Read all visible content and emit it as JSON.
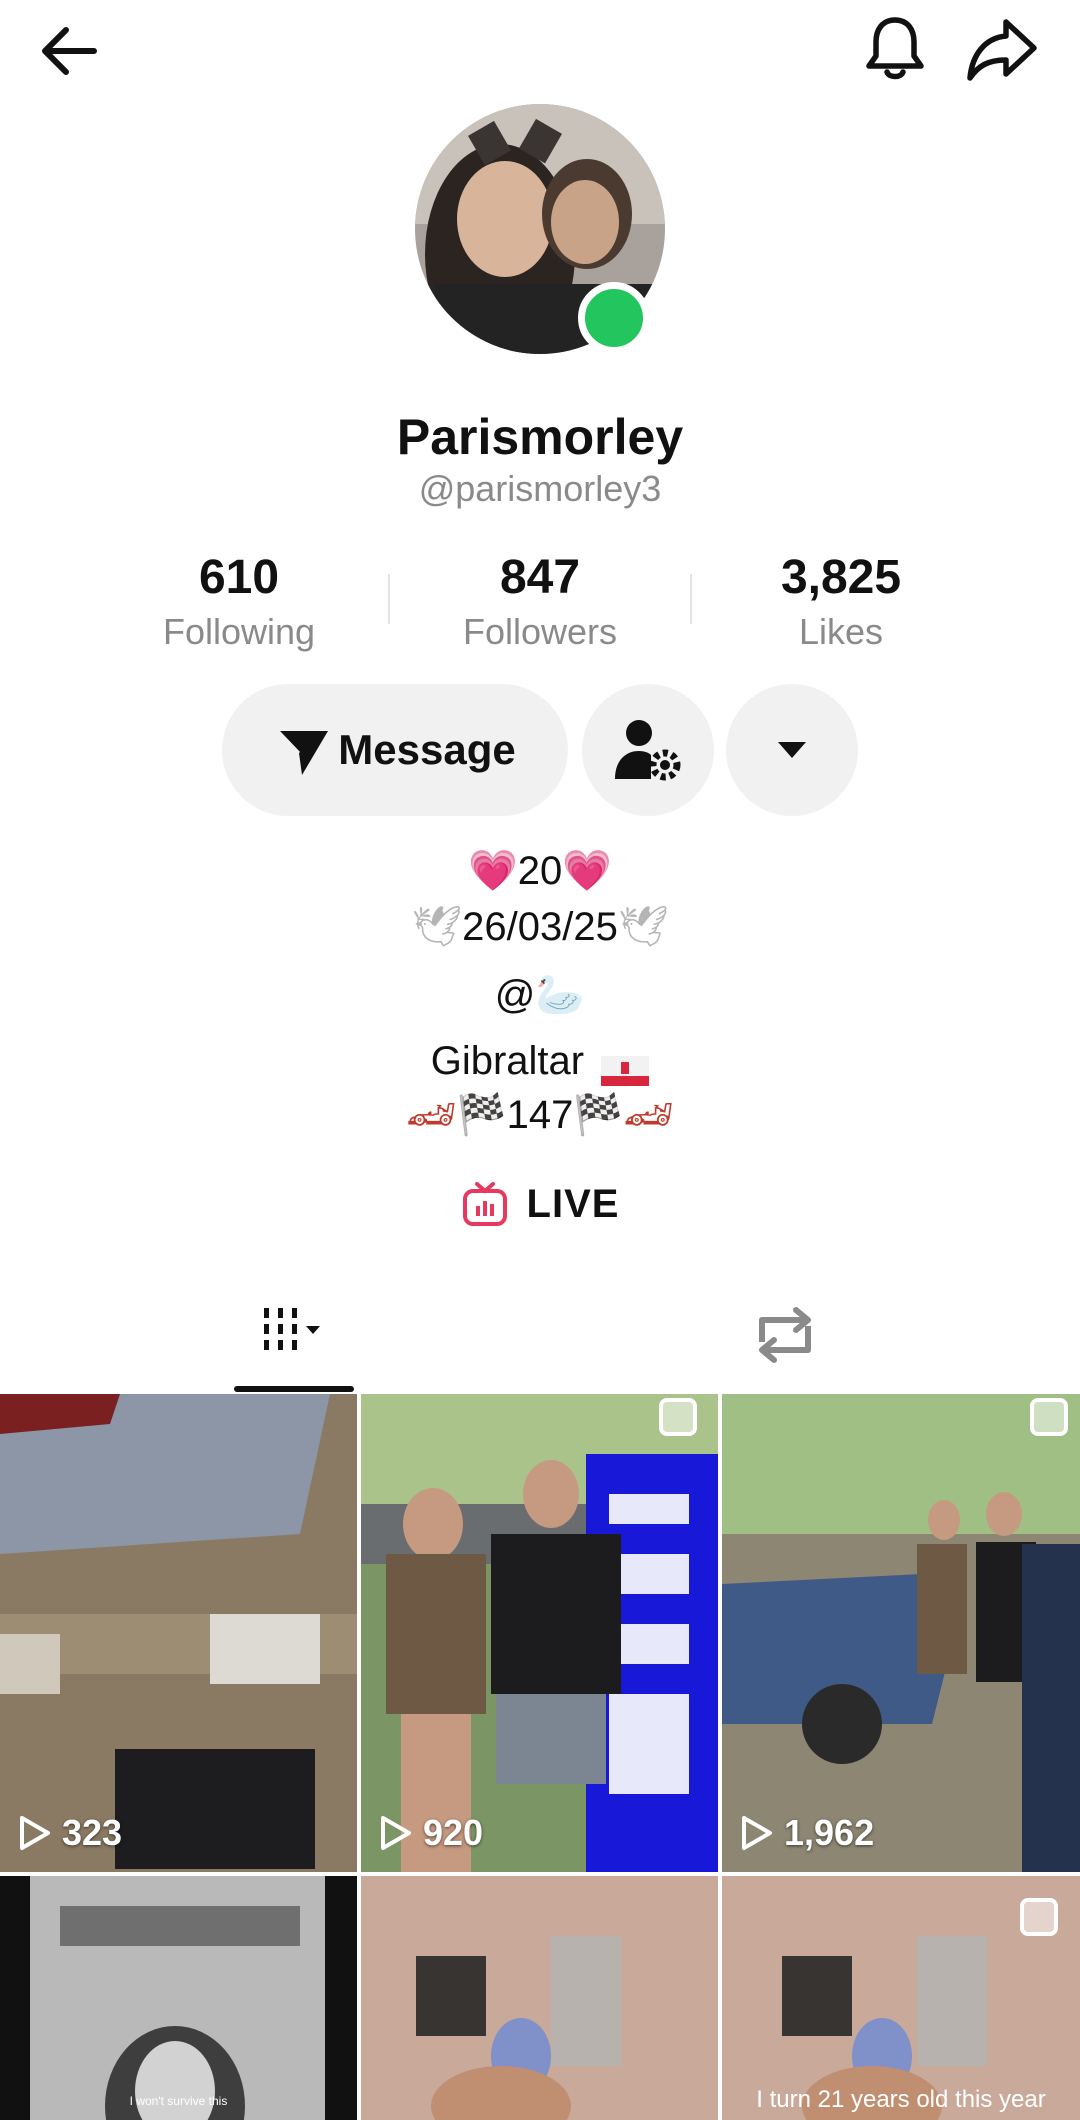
{
  "header": {
    "back_icon": "arrow-left-icon",
    "bell_icon": "bell-icon",
    "share_icon": "share-arrow-icon"
  },
  "profile": {
    "display_name": "Parismorley",
    "username": "@parismorley3",
    "online_status_color": "#22c55e"
  },
  "stats": [
    {
      "value": "610",
      "label": "Following"
    },
    {
      "value": "847",
      "label": "Followers"
    },
    {
      "value": "3,825",
      "label": "Likes"
    }
  ],
  "actions": {
    "message_label": "Message",
    "friend_settings_icon": "person-gear-icon",
    "more_icon": "caret-down-icon"
  },
  "bio": {
    "line1": "20",
    "line2": "26/03/25",
    "line3": "@",
    "line4": "Gibraltar",
    "line5": "147"
  },
  "live": {
    "label": "LIVE",
    "icon_color": "#e6395f"
  },
  "tabs": {
    "posts_icon": "grid-bars-icon",
    "repost_icon": "repost-icon"
  },
  "videos": [
    {
      "views": "323"
    },
    {
      "views": "920"
    },
    {
      "views": "1,962"
    },
    {
      "caption": "I won't survive this"
    },
    {
      "caption": ""
    },
    {
      "caption": "I turn 21 years old this year"
    }
  ]
}
